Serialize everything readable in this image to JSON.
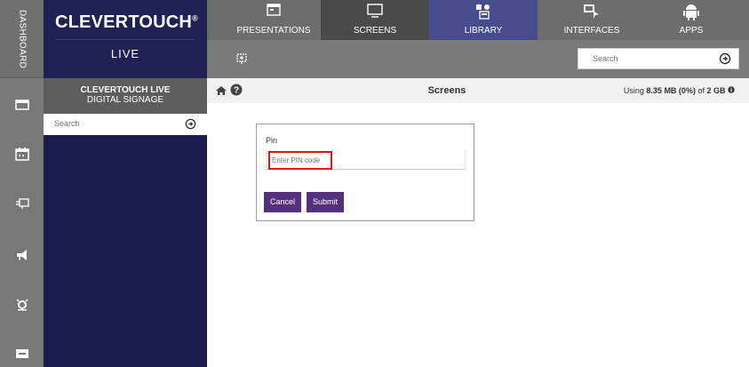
{
  "rail": {
    "dashboard_label": "DASHBOARD",
    "icons": [
      "presentation-icon",
      "calendar-icon",
      "screens-icon",
      "megaphone-icon",
      "alarm-icon",
      "display-icon"
    ]
  },
  "brand": {
    "title": "CLEVERTOUCH",
    "registered": "®",
    "subtitle": "LIVE"
  },
  "nav": {
    "tabs": [
      {
        "label": "PRESENTATIONS",
        "icon": "presentation-icon"
      },
      {
        "label": "SCREENS",
        "icon": "monitor-icon"
      },
      {
        "label": "LIBRARY",
        "icon": "library-icon"
      },
      {
        "label": "INTERFACES",
        "icon": "interfaces-icon"
      },
      {
        "label": "APPS",
        "icon": "android-icon"
      }
    ],
    "active": "SCREENS"
  },
  "subbar": {
    "search_placeholder": "Search"
  },
  "left_panel": {
    "heading_line1": "CLEVERTOUCH LIVE",
    "heading_line2": "DIGITAL SIGNAGE",
    "search_placeholder": "Search"
  },
  "content_header": {
    "title": "Screens",
    "usage_prefix": "Using ",
    "usage_used": "8.35 MB (0%)",
    "usage_mid": " of ",
    "usage_total": "2 GB"
  },
  "dialog": {
    "pin_label": "Pin",
    "pin_placeholder": "Enter PIN code",
    "cancel_label": "Cancel",
    "submit_label": "Submit"
  },
  "colors": {
    "brand_navy": "#1f2155",
    "button_purple": "#55307f",
    "highlight_red": "#e0141d"
  }
}
